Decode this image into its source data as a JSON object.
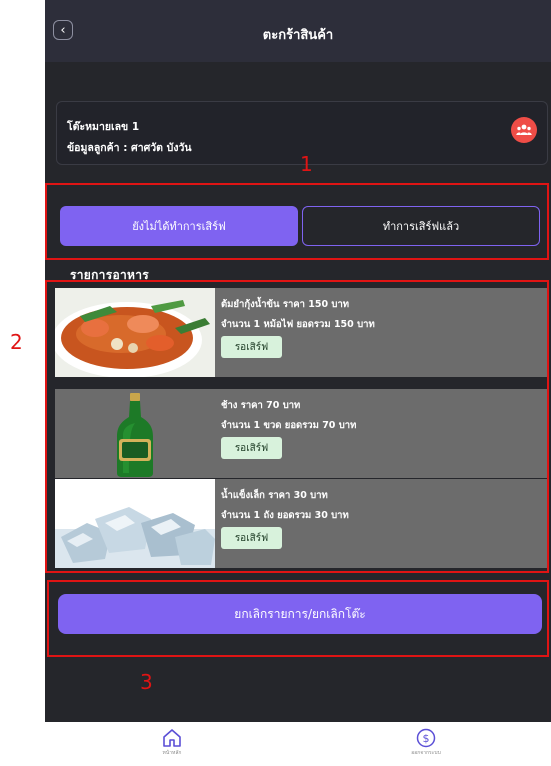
{
  "header": {
    "title": "ตะกร้าสินค้า",
    "back_icon": "chevron-left-icon"
  },
  "info": {
    "table": "โต๊ะหมายเลข 1",
    "customer": "ข้อมูลลูกค้า : ศาศวัต บังวัน",
    "icon": "people-icon"
  },
  "tabs": {
    "active": "ยังไม่ได้ทำการเสิร์ฟ",
    "inactive": "ทำการเสิร์ฟแล้ว"
  },
  "list_title": "รายการอาหาร",
  "items": [
    {
      "line1": "ต้มยำกุ้งน้ำข้น ราคา 150 บาท",
      "line2": "จำนวน 1 หม้อไฟ ยอดรวม 150 บาท",
      "status": "รอเสิร์ฟ"
    },
    {
      "line1": "ช้าง ราคา 70 บาท",
      "line2": "จำนวน 1 ขวด ยอดรวม 70 บาท",
      "status": "รอเสิร์ฟ"
    },
    {
      "line1": "น้ำแข็งเล็ก ราคา 30 บาท",
      "line2": "จำนวน 1 ถัง ยอดรวม 30 บาท",
      "status": "รอเสิร์ฟ"
    }
  ],
  "cancel_label": "ยกเลิกรายการ/ยกเลิกโต๊ะ",
  "nav": [
    {
      "label": "หน้าหลัก",
      "icon": "home-icon"
    },
    {
      "label": "ออกจากระบบ",
      "icon": "dollar-icon"
    }
  ],
  "annotations": [
    "1",
    "2",
    "3"
  ],
  "colors": {
    "accent": "#7f63f1",
    "background": "#25262b",
    "annotation": "#e01414",
    "badge": "#d8f2dc",
    "alert": "#ef4d47"
  }
}
